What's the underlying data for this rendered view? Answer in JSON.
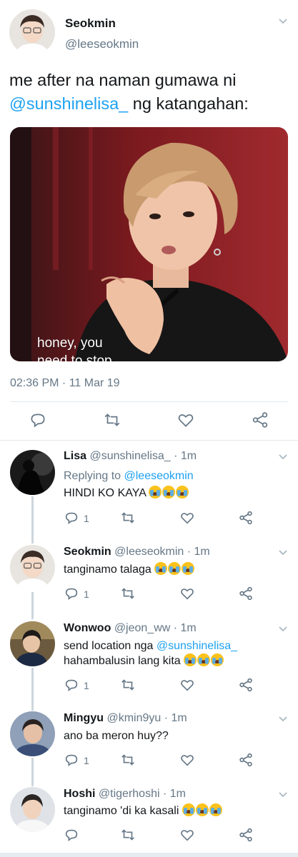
{
  "main_tweet": {
    "author_name": "Seokmin",
    "author_handle": "@leeseokmin",
    "text_before": "me after na naman gumawa ni",
    "mention": "@sunshinelisa_",
    "text_after": " ng katangahan:",
    "meme_caption_line1": "honey, you",
    "meme_caption_line2": "need to stop",
    "timestamp": "02:36 PM · 11 Mar 19",
    "icons": [
      "reply-icon",
      "retweet-icon",
      "like-icon",
      "share-icon"
    ]
  },
  "replies": [
    {
      "name": "Lisa",
      "meta": "@sunshinelisa_ · 1m",
      "replying_prefix": "Replying to ",
      "replying_to": "@leeseokmin",
      "text": "HINDI KO KAYA",
      "emoji_count": 3,
      "reply_count": "1"
    },
    {
      "name": "Seokmin",
      "meta": "@leeseokmin · 1m",
      "text": "tanginamo talaga",
      "emoji_count": 3,
      "reply_count": "1"
    },
    {
      "name": "Wonwoo",
      "meta": "@jeon_ww · 1m",
      "text_line1_before": "send location nga ",
      "text_line1_mention": "@sunshinelisa_",
      "text_line2": "hahambalusin lang kita",
      "emoji_count": 3,
      "reply_count": "1"
    },
    {
      "name": "Mingyu",
      "meta": "@kmin9yu · 1m",
      "text": "ano ba meron huy??",
      "reply_count": "1"
    },
    {
      "name": "Hoshi",
      "meta": "@tigerhoshi · 1m",
      "text": "tanginamo 'di ka kasali",
      "emoji_count": 3,
      "reply_count": ""
    }
  ],
  "colors": {
    "accent": "#1da1f2",
    "secondary_text": "#657786",
    "primary_text": "#14171a",
    "divider": "#e1e8ed",
    "thread_line": "#ccd6dd"
  }
}
